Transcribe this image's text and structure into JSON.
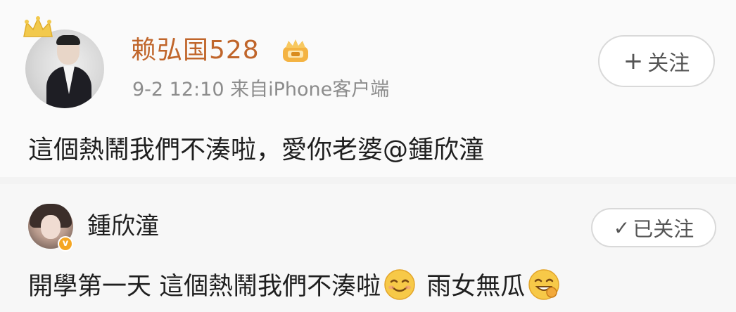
{
  "post": {
    "author": "赖弘国528",
    "meta": "9-2 12:10 来自iPhone客户端",
    "follow_label": "关注",
    "follow_plus": "+",
    "text": "這個熱鬧我們不湊啦，愛你老婆@鍾欣潼"
  },
  "reply": {
    "author": "鍾欣潼",
    "followed_label": "已关注",
    "followed_check": "✓",
    "verified_mark": "v",
    "text_part1": "開學第一天 這個熱鬧我們不湊啦",
    "text_part2": "雨女無瓜"
  },
  "colors": {
    "vip_name": "#c0652a",
    "meta_gray": "#8c8c8c",
    "crown_gold": "#f2c94c",
    "verified_badge": "#f5a623"
  },
  "icons": [
    "crown-icon",
    "vip-badge-icon",
    "verified-icon",
    "smile-emoji-icon",
    "grin-emoji-icon",
    "check-icon",
    "plus-icon"
  ]
}
